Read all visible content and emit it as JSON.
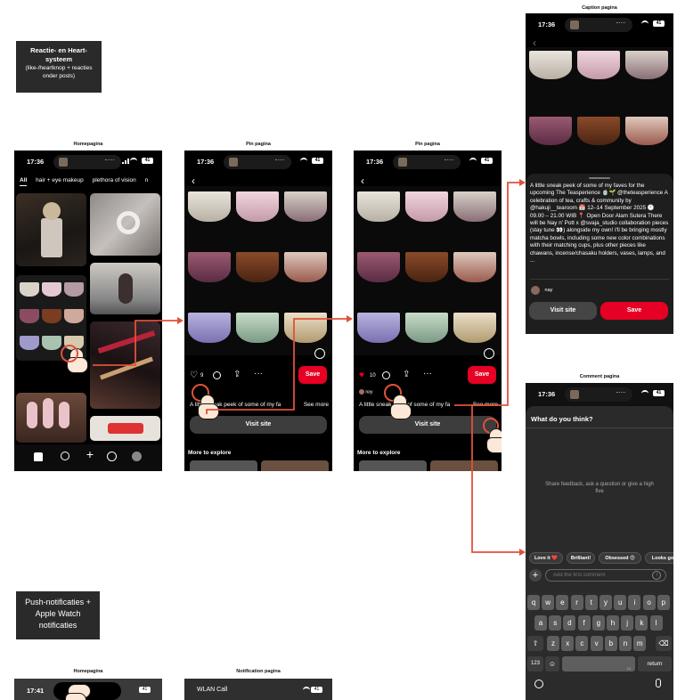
{
  "notes": {
    "reactie": {
      "title": "Reactie- en Heart-systeem",
      "sub": "(like-/heartknop + reacties onder posts)"
    },
    "push": {
      "title": "Push-notificaties + Apple Watch notificaties"
    }
  },
  "labels": {
    "home": "Homepagina",
    "pin1": "Pin pagina",
    "pin2": "Pin pagina",
    "caption": "Caption pagina",
    "comment": "Comment pagina",
    "home_bottom": "Homepagina",
    "notification": "Notification pagina"
  },
  "status": {
    "time": "17:36",
    "time_bottom": "17:41",
    "battery": "41",
    "wlan": "WLAN Call"
  },
  "home": {
    "tabs": [
      "All",
      "hair + eye makeup",
      "plethora of vision",
      "n"
    ]
  },
  "pin": {
    "save": "Save",
    "caption_preview": "A little sneak peek of some of my fa",
    "see_more": "See more",
    "visit_site": "Visit site",
    "more_to_explore": "More to explore",
    "like_count_1": "9",
    "like_count_2": "10",
    "user": "nay"
  },
  "caption_page": {
    "text": "A little sneak peek of some of my faves for the upcoming The Teasperience 🍵🌱 @theteasperience A celebration of tea, crafts & community by @hakuji__tearoom 📅 12–14 September 2025 🕘 09.00 – 21.00 WIB 📍 Open Door Alam Sutera There will be Nay n' Pott x @svaja_studio collaboration pieces (stay tune 👀) alongside my own! I'll be bringing mostly matcha bowls, including some new color combinations with their matching cups, plus other pieces like chawans, incense/chasaku holders, vases, lamps, and ...",
    "user": "nay",
    "visit_site": "Visit site",
    "save": "Save"
  },
  "comment_page": {
    "title": "What do you think?",
    "empty": "Share feedback, ask a question or give a high five",
    "chips": [
      "Love it ❤️",
      "Brilliant!",
      "Obsessed 😍",
      "Looks go"
    ],
    "placeholder": "Add the first comment",
    "rows": [
      [
        "q",
        "w",
        "e",
        "r",
        "t",
        "y",
        "u",
        "i",
        "o",
        "p"
      ],
      [
        "a",
        "s",
        "d",
        "f",
        "g",
        "h",
        "j",
        "k",
        "l"
      ],
      [
        "z",
        "x",
        "c",
        "v",
        "b",
        "n",
        "m"
      ]
    ],
    "key_123": "123",
    "key_return": "return",
    "key_nl": "NL"
  },
  "colors": {
    "accent": "#e60023",
    "arrow": "#e0513a",
    "note_bg": "#2a2a2a"
  }
}
